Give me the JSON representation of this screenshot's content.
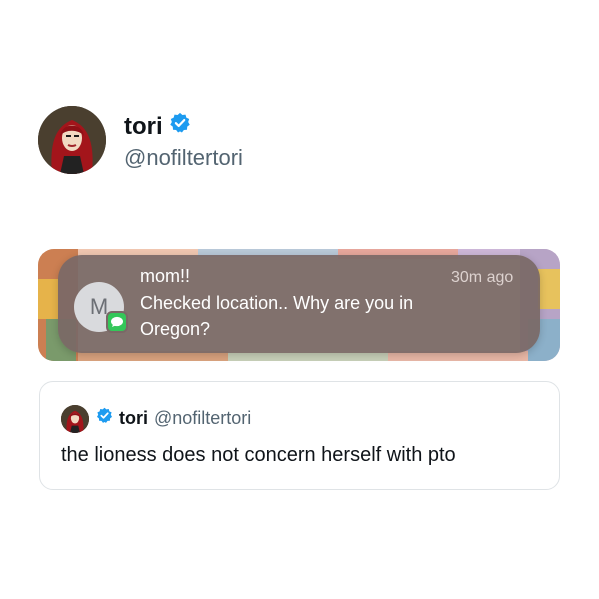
{
  "author": {
    "name": "tori",
    "handle": "@nofiltertori",
    "verified": true
  },
  "notification": {
    "avatar_initial": "M",
    "sender": "mom!!",
    "time": "30m ago",
    "body": "Checked location.. Why are you in Oregon?",
    "app_icon": "messages-icon"
  },
  "quote": {
    "name": "tori",
    "handle": "@nofiltertori",
    "text": "the lioness does not concern herself with pto"
  },
  "colors": {
    "verified": "#1d9bf0",
    "messages_green": "#34c759",
    "notification_bg": "#7a6866"
  }
}
